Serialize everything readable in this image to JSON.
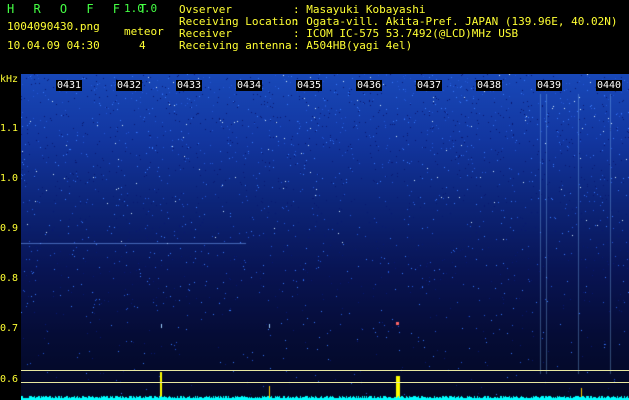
{
  "app": {
    "name": "H R O F F T",
    "version": "1.0.0",
    "filename": "1004090430.png",
    "datetime": "10.04.09 04:30",
    "meteor_label": "meteor",
    "meteor_count": "4"
  },
  "info": {
    "rows": [
      {
        "label": "Ovserver",
        "value": ": Masayuki Kobayashi"
      },
      {
        "label": "Receiving Location",
        "value": ": Ogata-vill. Akita-Pref. JAPAN (139.96E, 40.02N)"
      },
      {
        "label": "Receiver",
        "value": ": ICOM IC-575 53.7492(@LCD)MHz USB"
      },
      {
        "label": "Receiving antenna",
        "value": ": A504HB(yagi 4el)"
      }
    ]
  },
  "axis": {
    "unit": "kHz",
    "ticks": [
      "1.1",
      "1.0",
      "0.9",
      "0.8",
      "0.7",
      "0.6"
    ]
  },
  "time_marks": [
    "0431",
    "0432",
    "0433",
    "0434",
    "0435",
    "0436",
    "0437",
    "0438",
    "0439",
    "0440"
  ],
  "colors": {
    "accent_green": "#44ff44",
    "label_yellow": "#ffff33",
    "spectrum_blue": "#1848b8",
    "meteor_yellow": "#ffff00",
    "baseline_cyan": "#00ffff"
  }
}
